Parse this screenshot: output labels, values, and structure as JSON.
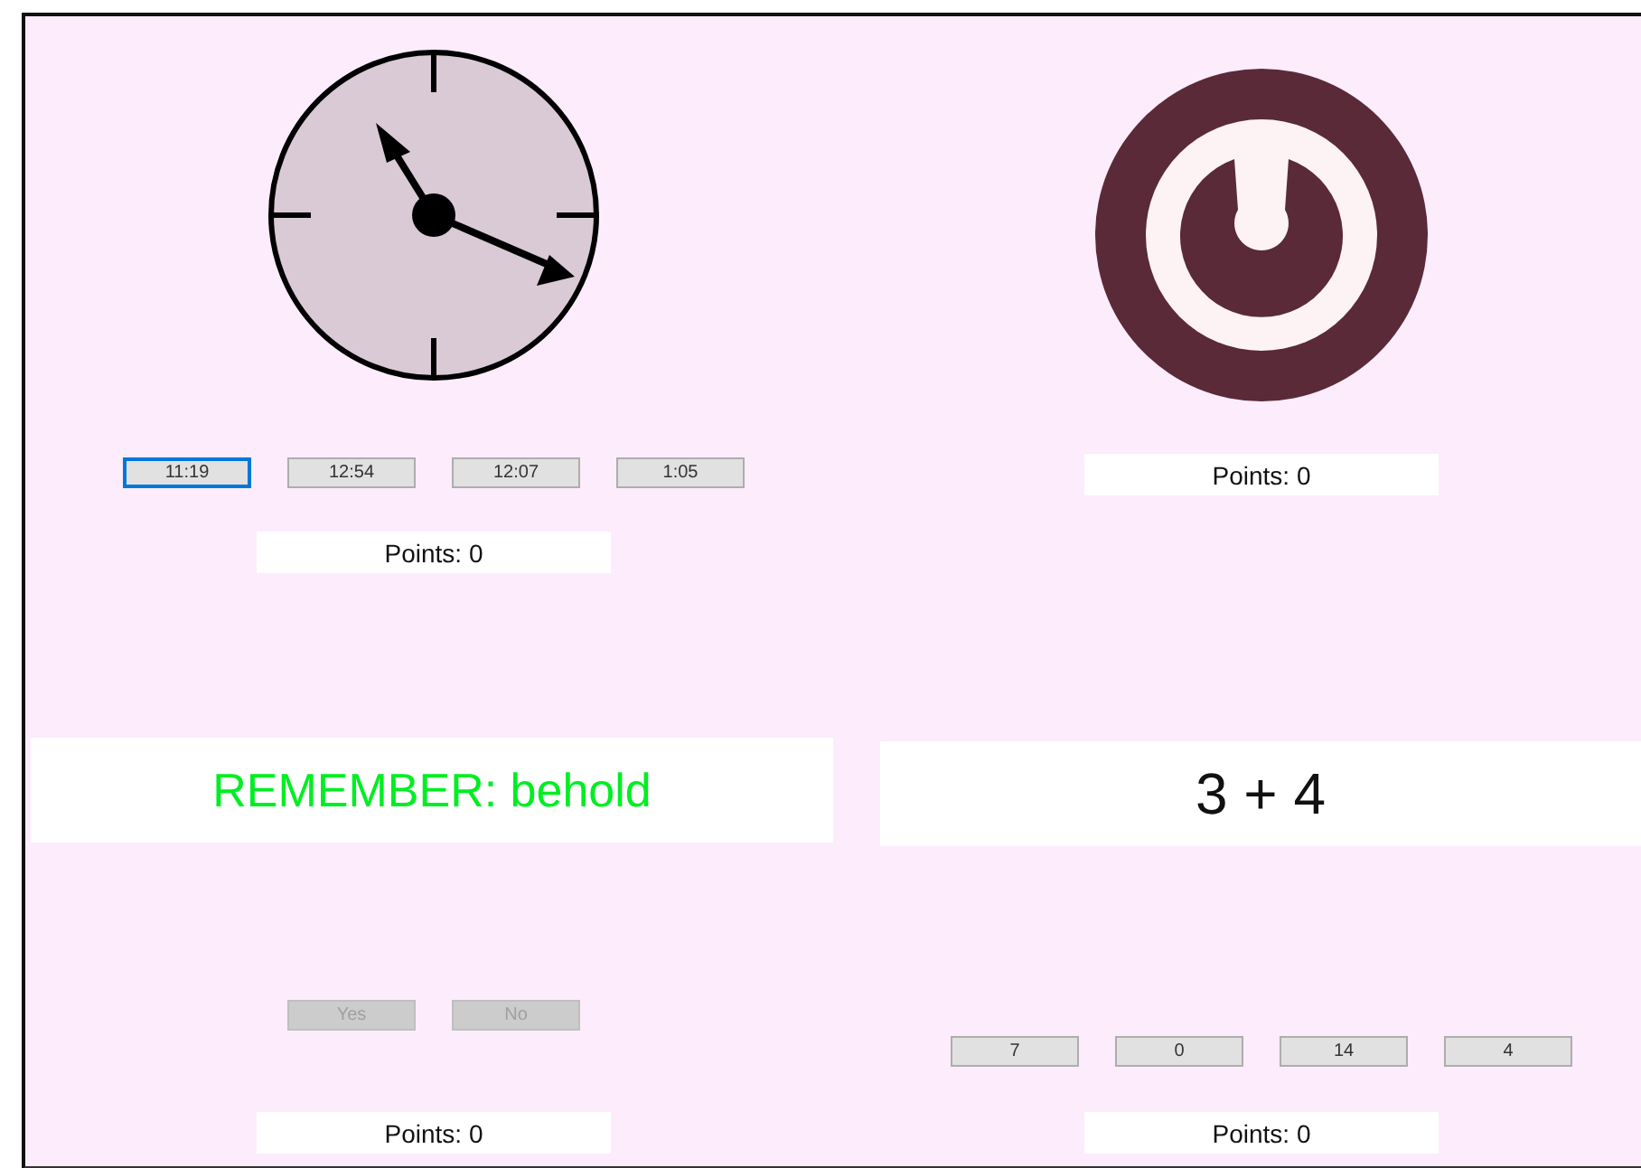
{
  "clock_game": {
    "answers": [
      {
        "label": "11:19",
        "focused": true,
        "disabled": false
      },
      {
        "label": "12:54",
        "focused": false,
        "disabled": false
      },
      {
        "label": "12:07",
        "focused": false,
        "disabled": false
      },
      {
        "label": "1:05",
        "focused": false,
        "disabled": false
      }
    ],
    "points": "Points: 0"
  },
  "power_game": {
    "points": "Points: 0"
  },
  "memory_game": {
    "prompt": "REMEMBER: behold",
    "answers": [
      {
        "label": "Yes",
        "focused": false,
        "disabled": true
      },
      {
        "label": "No",
        "focused": false,
        "disabled": true
      }
    ],
    "points": "Points: 0"
  },
  "math_game": {
    "prompt": "3 + 4",
    "answers": [
      {
        "label": "7",
        "focused": false,
        "disabled": false
      },
      {
        "label": "0",
        "focused": false,
        "disabled": false
      },
      {
        "label": "14",
        "focused": false,
        "disabled": false
      },
      {
        "label": "4",
        "focused": false,
        "disabled": false
      }
    ],
    "points": "Points: 0"
  }
}
